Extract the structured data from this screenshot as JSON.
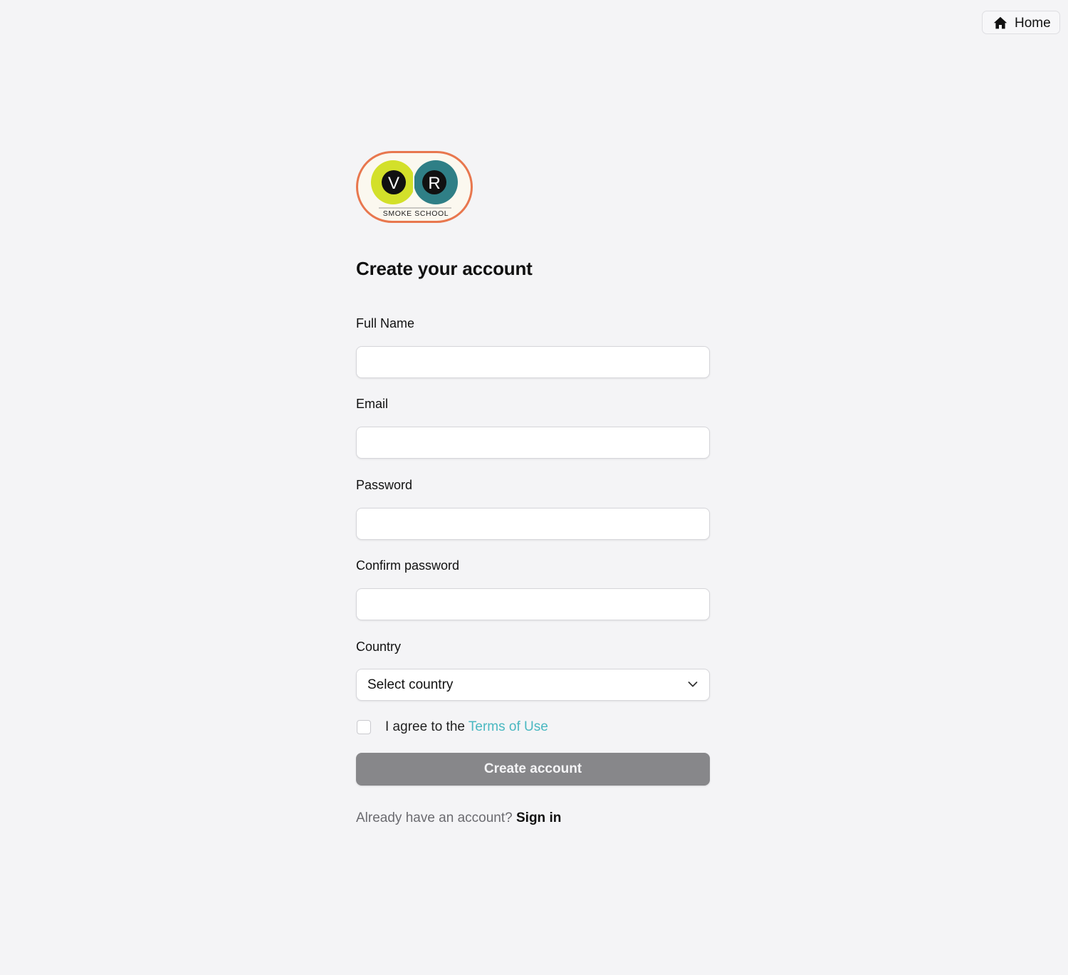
{
  "nav": {
    "home_label": "Home",
    "home_icon": "home-icon"
  },
  "logo": {
    "letter_left": "V",
    "letter_right": "R",
    "caption": "SMOKE SCHOOL",
    "colors": {
      "ring": "#e8774e",
      "left_circle": "#d3e02a",
      "right_circle": "#2f7f86",
      "letter_bg": "#111111",
      "background": "#fbf8ef"
    }
  },
  "form": {
    "title": "Create your account",
    "fields": [
      {
        "label": "Full Name",
        "value": "",
        "placeholder": ""
      },
      {
        "label": "Email",
        "value": "",
        "placeholder": ""
      },
      {
        "label": "Password",
        "value": "",
        "placeholder": ""
      },
      {
        "label": "Confirm password",
        "value": "",
        "placeholder": ""
      }
    ],
    "country": {
      "label": "Country",
      "selected": "Select country"
    },
    "agree": {
      "prefix": "I agree to the ",
      "link": "Terms of Use",
      "checked": false
    },
    "submit_label": "Create account",
    "footer": {
      "prompt": "Already have an account? ",
      "link": "Sign in"
    }
  },
  "colors": {
    "page_bg": "#f4f4f6",
    "link_accent": "#4ab8c1",
    "button_disabled_bg": "#87878a"
  }
}
